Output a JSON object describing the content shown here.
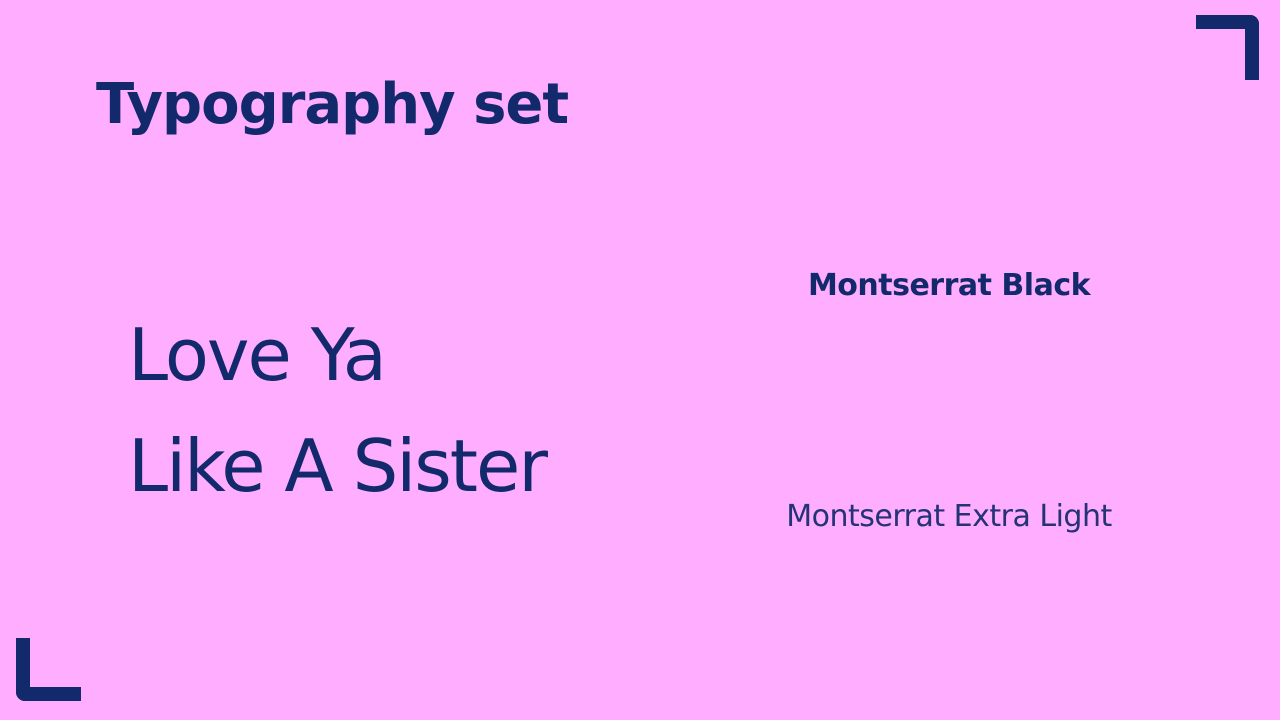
{
  "slide": {
    "title": "Typography set",
    "sample_text": {
      "line1": "Love Ya",
      "line2": "Like A Sister"
    },
    "font_labels": {
      "heavy": "Montserrat Black",
      "light": "Montserrat Extra Light"
    }
  },
  "colors": {
    "background": "#ffadfe",
    "accent": "#12296b"
  },
  "icons": {
    "top_right": "corner-bracket-icon",
    "bottom_left": "corner-bracket-icon"
  }
}
